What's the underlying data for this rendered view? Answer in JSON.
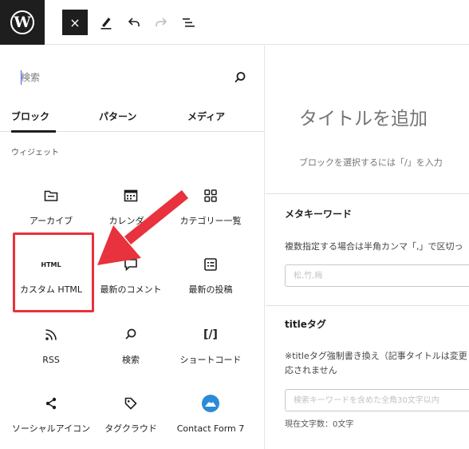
{
  "toolbar": {
    "logo_letter": "W",
    "close_glyph": "×",
    "icons": [
      "wordpress-logo-icon",
      "close-icon",
      "pencil-icon",
      "undo-icon",
      "redo-icon",
      "list-view-icon"
    ]
  },
  "inserter": {
    "search": {
      "placeholder": "検索",
      "value": ""
    },
    "tabs": [
      {
        "label": "ブロック",
        "active": true
      },
      {
        "label": "パターン",
        "active": false
      },
      {
        "label": "メディア",
        "active": false
      }
    ],
    "section": "ウィジェット",
    "blocks": [
      {
        "label": "アーカイブ",
        "icon": "archive-folder-icon"
      },
      {
        "label": "カレンダー",
        "icon": "calendar-icon"
      },
      {
        "label": "カテゴリー一覧",
        "icon": "categories-grid-icon"
      },
      {
        "label": "カスタム HTML",
        "icon": "html-icon",
        "icon_text": "HTML",
        "highlighted": true
      },
      {
        "label": "最新のコメント",
        "icon": "comment-icon"
      },
      {
        "label": "最新の投稿",
        "icon": "post-list-icon"
      },
      {
        "label": "RSS",
        "icon": "rss-icon"
      },
      {
        "label": "検索",
        "icon": "search-icon"
      },
      {
        "label": "ショートコード",
        "icon": "shortcode-icon",
        "icon_text": "[/]"
      },
      {
        "label": "ソーシャルアイコン",
        "icon": "share-icon"
      },
      {
        "label": "タグクラウド",
        "icon": "tag-icon"
      },
      {
        "label": "Contact Form 7",
        "icon": "contact-form-7-icon"
      }
    ]
  },
  "editor": {
    "title_placeholder": "タイトルを追加",
    "block_prompt": "ブロックを選択するには「/」を入力",
    "meta_keyword": {
      "title": "メタキーワード",
      "description": "複数指定する場合は半角カンマ「,」で区切っ",
      "placeholder": "松,竹,梅"
    },
    "title_tag": {
      "title": "titleタグ",
      "description_line1": "※titleタグ強制書き換え（記事タイトルは変更",
      "description_line2": "応されません",
      "placeholder": "検索キーワードを含めた全角30文字以内",
      "counter": "現在文字数：0文字"
    }
  },
  "colors": {
    "highlight": "#e8323d",
    "arrow": "#e8323d",
    "dark": "#1e1e1e",
    "accent": "#3858e9"
  }
}
